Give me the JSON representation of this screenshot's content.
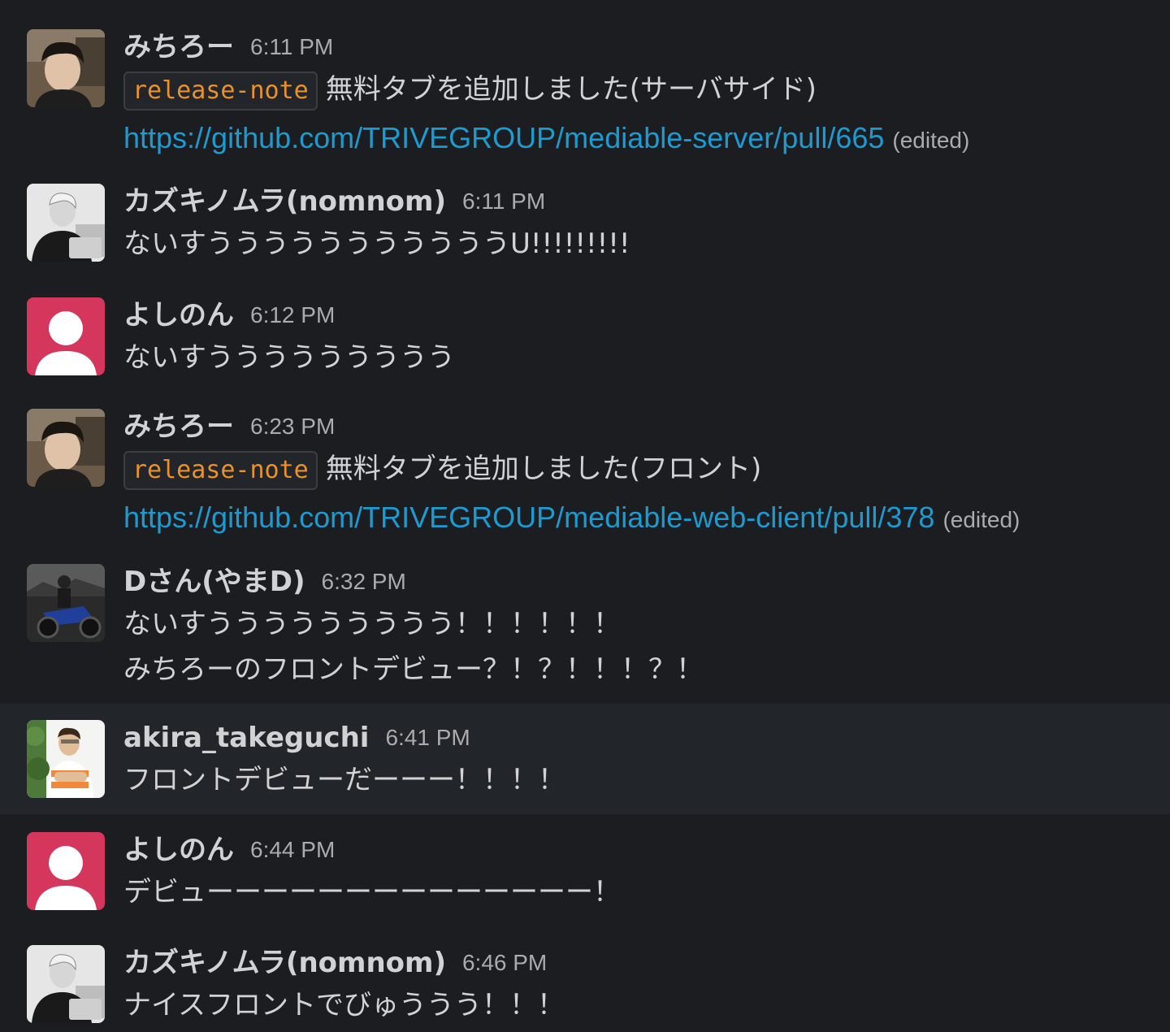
{
  "colors": {
    "background": "#1b1d21",
    "hover_row": "#222529",
    "text": "#d1d2d3",
    "timestamp": "#ababad",
    "link": "#1d9bd1",
    "code": "#e8912d",
    "default_avatar": "#d4365c"
  },
  "messages": [
    {
      "author": "みちろー",
      "time": "6:11 PM",
      "code_tag": "release-note",
      "text": "無料タブを追加しました(サーバサイド)",
      "link": "https://github.com/TRIVEGROUP/mediable-server/pull/665",
      "edited": "(edited)"
    },
    {
      "author": "カズキノムラ(nomnom)",
      "time": "6:11 PM",
      "text": "ないすうううううううううううU!!!!!!!!!"
    },
    {
      "author": "よしのん",
      "time": "6:12 PM",
      "text": "ないすううううううううう"
    },
    {
      "author": "みちろー",
      "time": "6:23 PM",
      "code_tag": "release-note",
      "text": "無料タブを追加しました(フロント)",
      "link": "https://github.com/TRIVEGROUP/mediable-web-client/pull/378",
      "edited": "(edited)"
    },
    {
      "author": "Dさん(やまD)",
      "time": "6:32 PM",
      "lines": [
        "ないすううううううううう！！！！！！",
        "みちろーのフロントデビュー？！？！！！？！"
      ]
    },
    {
      "author": "akira_takeguchi",
      "time": "6:41 PM",
      "text": "フロントデビューだーーー！！！！"
    },
    {
      "author": "よしのん",
      "time": "6:44 PM",
      "text": "デビューーーーーーーーーーーーーー！"
    },
    {
      "author": "カズキノムラ(nomnom)",
      "time": "6:46 PM",
      "text": "ナイスフロントでびゅううう！！！"
    }
  ]
}
